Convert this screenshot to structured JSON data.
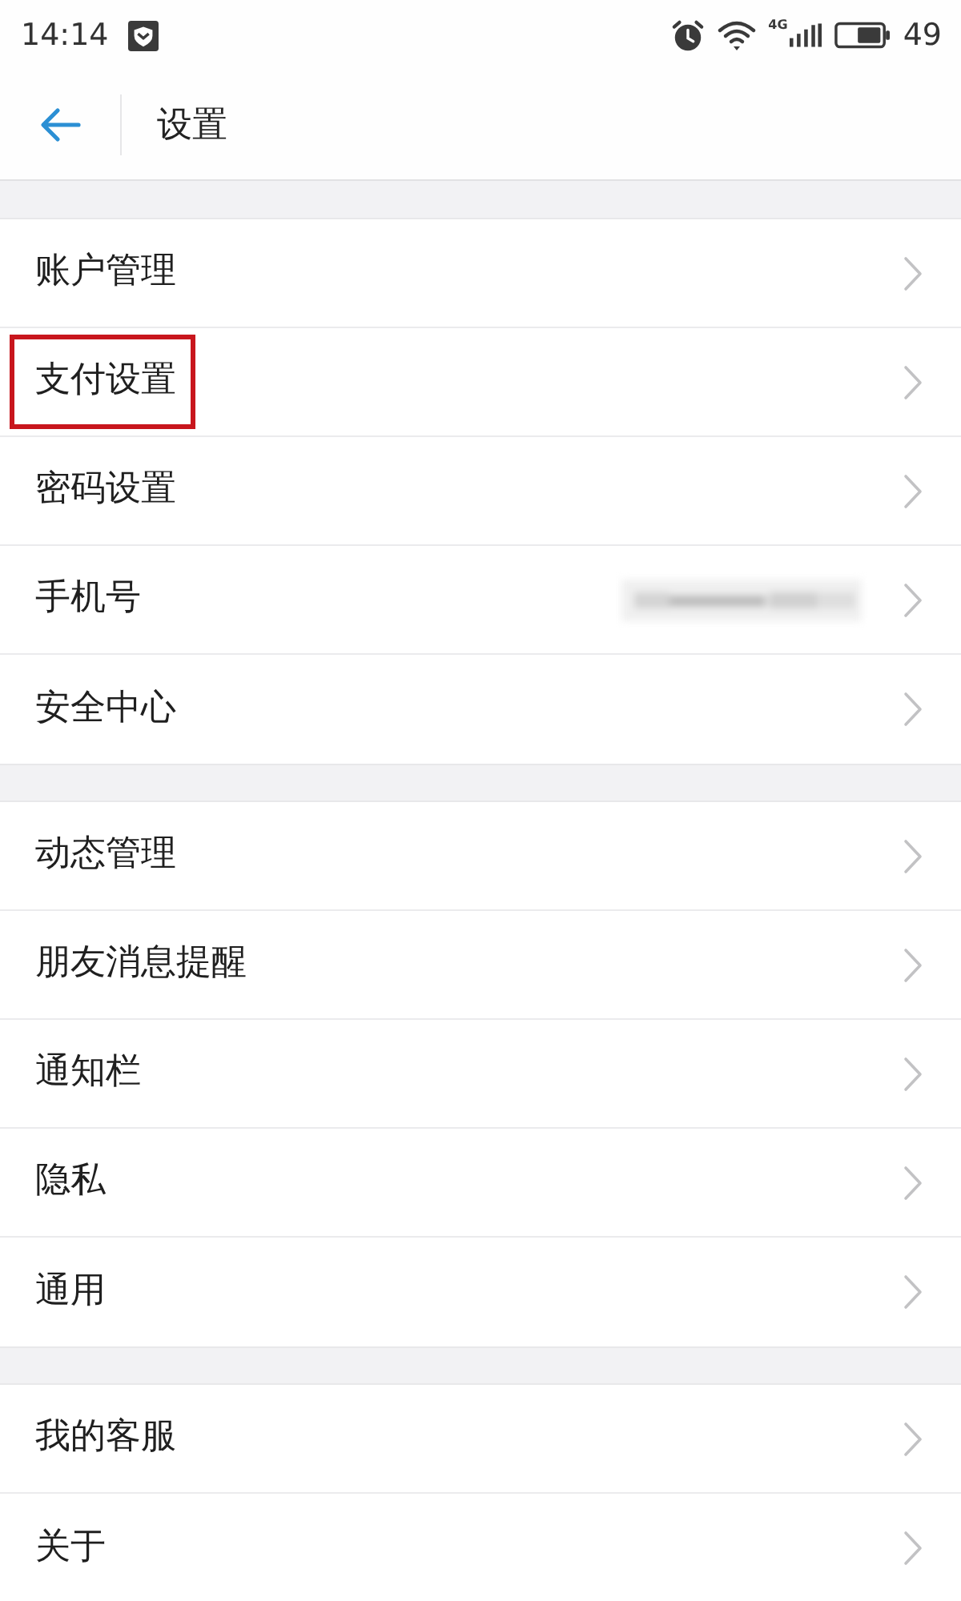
{
  "status_bar": {
    "time": "14:14",
    "network": "4G",
    "battery": "49"
  },
  "header": {
    "title": "设置"
  },
  "sections": [
    {
      "items": [
        {
          "label": "账户管理",
          "highlighted": false,
          "value_blurred": false
        },
        {
          "label": "支付设置",
          "highlighted": true,
          "value_blurred": false
        },
        {
          "label": "密码设置",
          "highlighted": false,
          "value_blurred": false
        },
        {
          "label": "手机号",
          "highlighted": false,
          "value_blurred": true
        },
        {
          "label": "安全中心",
          "highlighted": false,
          "value_blurred": false
        }
      ]
    },
    {
      "items": [
        {
          "label": "动态管理",
          "highlighted": false,
          "value_blurred": false
        },
        {
          "label": "朋友消息提醒",
          "highlighted": false,
          "value_blurred": false
        },
        {
          "label": "通知栏",
          "highlighted": false,
          "value_blurred": false
        },
        {
          "label": "隐私",
          "highlighted": false,
          "value_blurred": false
        },
        {
          "label": "通用",
          "highlighted": false,
          "value_blurred": false
        }
      ]
    },
    {
      "items": [
        {
          "label": "我的客服",
          "highlighted": false,
          "value_blurred": false
        },
        {
          "label": "关于",
          "highlighted": false,
          "value_blurred": false
        }
      ]
    }
  ]
}
